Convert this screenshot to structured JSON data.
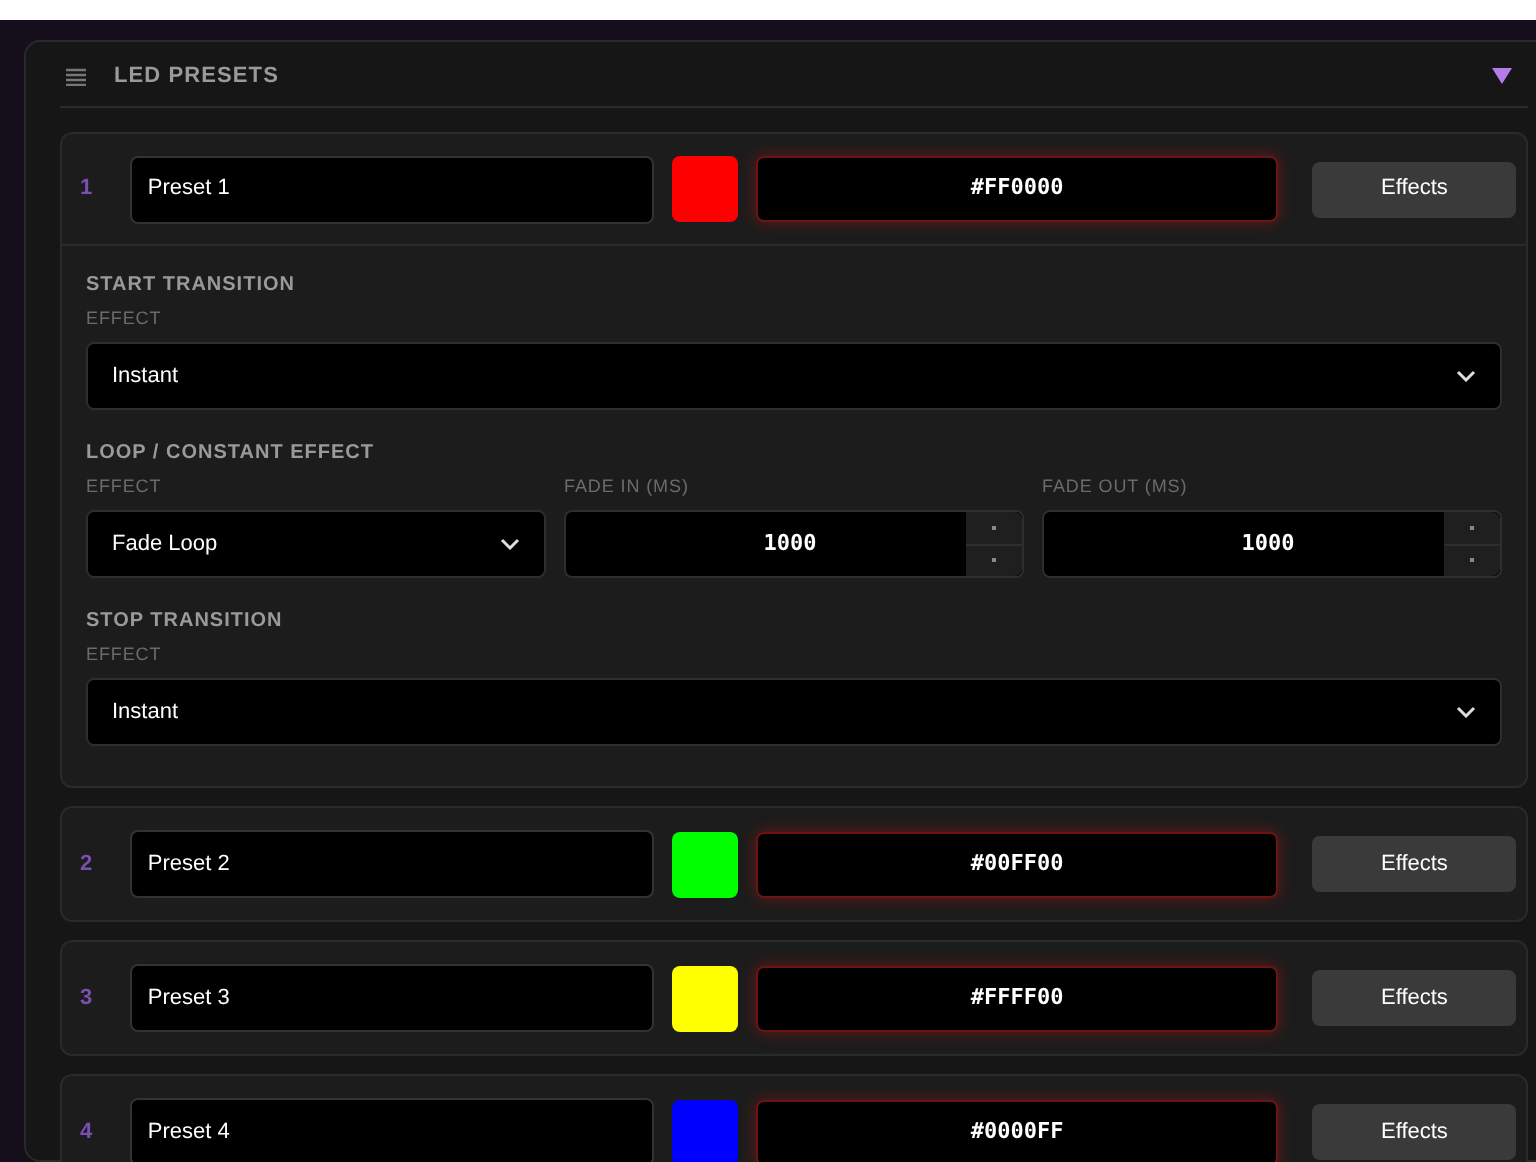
{
  "panel": {
    "title": "LED PRESETS",
    "collapse_open": true
  },
  "presets": [
    {
      "number": "1",
      "name": "Preset 1",
      "color": "#ff0000",
      "hex": "#FF0000",
      "button": "Effects",
      "expanded": true,
      "sections": [
        {
          "title": "START TRANSITION",
          "fields": [
            {
              "kind": "select",
              "label": "EFFECT",
              "value": "Instant"
            }
          ]
        },
        {
          "title": "LOOP / CONSTANT EFFECT",
          "fields": [
            {
              "kind": "select",
              "label": "EFFECT",
              "value": "Fade Loop"
            },
            {
              "kind": "number",
              "label": "FADE IN (MS)",
              "value": "1000"
            },
            {
              "kind": "number",
              "label": "FADE OUT (MS)",
              "value": "1000"
            }
          ]
        },
        {
          "title": "STOP TRANSITION",
          "fields": [
            {
              "kind": "select",
              "label": "EFFECT",
              "value": "Instant"
            }
          ]
        }
      ]
    },
    {
      "number": "2",
      "name": "Preset 2",
      "color": "#00ff00",
      "hex": "#00FF00",
      "button": "Effects",
      "expanded": false
    },
    {
      "number": "3",
      "name": "Preset 3",
      "color": "#ffff00",
      "hex": "#FFFF00",
      "button": "Effects",
      "expanded": false
    },
    {
      "number": "4",
      "name": "Preset 4",
      "color": "#0000ff",
      "hex": "#0000FF",
      "button": "Effects",
      "expanded": false
    }
  ]
}
